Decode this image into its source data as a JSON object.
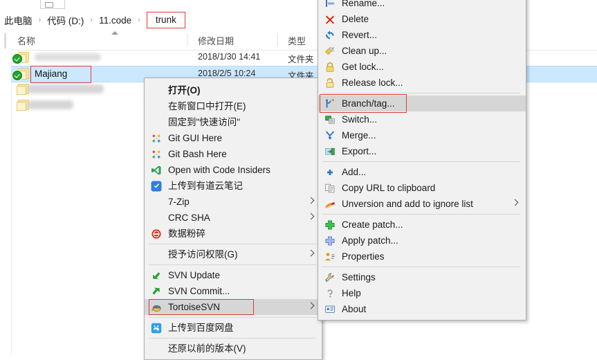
{
  "window": {
    "app": "windows-file-explorer"
  },
  "breadcrumb": {
    "items": [
      {
        "label": "此电脑",
        "boxed": false
      },
      {
        "label": "代码 (D:)",
        "boxed": false
      },
      {
        "label": "11.code",
        "boxed": false
      },
      {
        "label": "trunk",
        "boxed": true
      }
    ],
    "separator": "›"
  },
  "file_list": {
    "columns": [
      {
        "key": "name",
        "label": "名称"
      },
      {
        "key": "date",
        "label": "修改日期"
      },
      {
        "key": "type",
        "label": "类型"
      }
    ],
    "rows": [
      {
        "name": "",
        "blurred": true,
        "date": "2018/1/30 14:41",
        "type": "文件夹",
        "selected": false,
        "overlay": "svn-normal-overlay"
      },
      {
        "name": "Majiang",
        "blurred": false,
        "date": "2018/2/5 10:24",
        "type": "文件夹",
        "selected": true,
        "overlay": "svn-normal-overlay",
        "annotated": true
      },
      {
        "name": "",
        "blurred": true,
        "date": "",
        "type": "",
        "selected": false,
        "overlay": "none"
      },
      {
        "name": "",
        "blurred": true,
        "date": "",
        "type": "",
        "selected": false,
        "overlay": "none"
      }
    ]
  },
  "context_menu": {
    "name": "shell-context-menu",
    "items": [
      {
        "label": "打开(O)",
        "icon": "none",
        "bold": true,
        "submenu": false,
        "separator_after": false
      },
      {
        "label": "在新窗口中打开(E)",
        "icon": "none",
        "bold": false,
        "submenu": false,
        "separator_after": false
      },
      {
        "label": "固定到\"快速访问\"",
        "icon": "none",
        "bold": false,
        "submenu": false,
        "separator_after": false
      },
      {
        "label": "Git GUI Here",
        "icon": "git-icon",
        "bold": false,
        "submenu": false,
        "separator_after": false
      },
      {
        "label": "Git Bash Here",
        "icon": "git-icon",
        "bold": false,
        "submenu": false,
        "separator_after": false
      },
      {
        "label": "Open with Code Insiders",
        "icon": "vscode-insiders-icon",
        "bold": false,
        "submenu": false,
        "separator_after": false
      },
      {
        "label": "上传到有道云笔记",
        "icon": "youdao-note-icon",
        "bold": false,
        "submenu": false,
        "separator_after": false
      },
      {
        "label": "7-Zip",
        "icon": "none",
        "bold": false,
        "submenu": true,
        "separator_after": false
      },
      {
        "label": "CRC SHA",
        "icon": "none",
        "bold": false,
        "submenu": true,
        "separator_after": false
      },
      {
        "label": "数据粉碎",
        "icon": "shred-icon",
        "bold": false,
        "submenu": false,
        "separator_after": true
      },
      {
        "label": "授予访问权限(G)",
        "icon": "none",
        "bold": false,
        "submenu": true,
        "separator_after": true
      },
      {
        "label": "SVN Update",
        "icon": "svn-update-icon",
        "bold": false,
        "submenu": false,
        "separator_after": false
      },
      {
        "label": "SVN Commit...",
        "icon": "svn-commit-icon",
        "bold": false,
        "submenu": false,
        "separator_after": false
      },
      {
        "label": "TortoiseSVN",
        "icon": "tortoise-icon",
        "bold": false,
        "submenu": true,
        "separator_after": true,
        "highlighted": true,
        "annotated": true
      },
      {
        "label": "上传到百度网盘",
        "icon": "baidu-netdisk-icon",
        "bold": false,
        "submenu": false,
        "separator_after": true
      },
      {
        "label": "还原以前的版本(V)",
        "icon": "none",
        "bold": false,
        "submenu": false,
        "separator_after": false
      }
    ]
  },
  "submenu": {
    "name": "tortoisesvn-submenu",
    "items": [
      {
        "label": "Rename...",
        "icon": "rename-icon",
        "clipped": true,
        "separator_after": false
      },
      {
        "label": "Delete",
        "icon": "delete-icon",
        "separator_after": false
      },
      {
        "label": "Revert...",
        "icon": "revert-icon",
        "separator_after": false
      },
      {
        "label": "Clean up...",
        "icon": "cleanup-icon",
        "separator_after": false
      },
      {
        "label": "Get lock...",
        "icon": "lock-closed-icon",
        "separator_after": false
      },
      {
        "label": "Release lock...",
        "icon": "lock-open-icon",
        "separator_after": true
      },
      {
        "label": "Branch/tag...",
        "icon": "branch-tag-icon",
        "separator_after": false,
        "highlighted": true,
        "annotated": true
      },
      {
        "label": "Switch...",
        "icon": "switch-icon",
        "separator_after": false
      },
      {
        "label": "Merge...",
        "icon": "merge-icon",
        "separator_after": false
      },
      {
        "label": "Export...",
        "icon": "export-icon",
        "separator_after": true
      },
      {
        "label": "Add...",
        "icon": "add-icon",
        "separator_after": false
      },
      {
        "label": "Copy URL to clipboard",
        "icon": "copy-url-icon",
        "separator_after": false
      },
      {
        "label": "Unversion and add to ignore list",
        "icon": "unversion-icon",
        "submenu": true,
        "separator_after": true
      },
      {
        "label": "Create patch...",
        "icon": "create-patch-icon",
        "separator_after": false
      },
      {
        "label": "Apply patch...",
        "icon": "apply-patch-icon",
        "separator_after": false
      },
      {
        "label": "Properties",
        "icon": "properties-icon",
        "separator_after": true
      },
      {
        "label": "Settings",
        "icon": "settings-icon",
        "separator_after": false
      },
      {
        "label": "Help",
        "icon": "help-icon",
        "separator_after": false
      },
      {
        "label": "About",
        "icon": "about-icon",
        "separator_after": false
      }
    ]
  },
  "colors": {
    "annotation": "#e03a30",
    "selection": "#cce8ff",
    "menu_bg": "#f1f1f1",
    "menu_highlight": "#d6d6d6"
  }
}
